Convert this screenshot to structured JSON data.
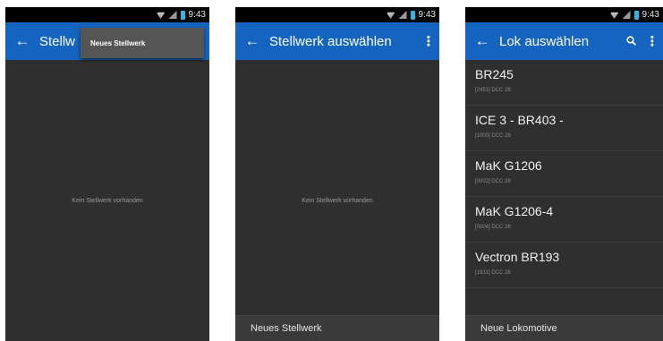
{
  "status": {
    "time": "9:43"
  },
  "screen1": {
    "title": "Stellw",
    "back_icon": "arrow-left",
    "menu_item": "Neues Stellwerk",
    "empty_text": "Kein Stellwerk vorhanden"
  },
  "screen2": {
    "title": "Stellwerk auswählen",
    "back_icon": "arrow-left",
    "more_icon": "⋮",
    "empty_text": "Kein Stellwerk vorhanden",
    "bottom_button": "Neues Stellwerk"
  },
  "screen3": {
    "title": "Lok auswählen",
    "back_icon": "arrow-left",
    "search_icon": "🔍",
    "more_icon": "⋮",
    "items": [
      {
        "name": "BR245",
        "sub": "[2451] DCC 28"
      },
      {
        "name": "ICE 3 - BR403 -",
        "sub": "[1000] DCC 28"
      },
      {
        "name": "MaK G1206",
        "sub": "[0002] DCC 28"
      },
      {
        "name": "MaK G1206-4",
        "sub": "[0004] DCC 28"
      },
      {
        "name": "Vectron BR193",
        "sub": "[1931] DCC 28"
      }
    ],
    "bottom_button": "Neue Lokomotive"
  },
  "colors": {
    "appbar": "#1565c0",
    "background": "#2f2f2f",
    "statusbar": "#000000"
  }
}
